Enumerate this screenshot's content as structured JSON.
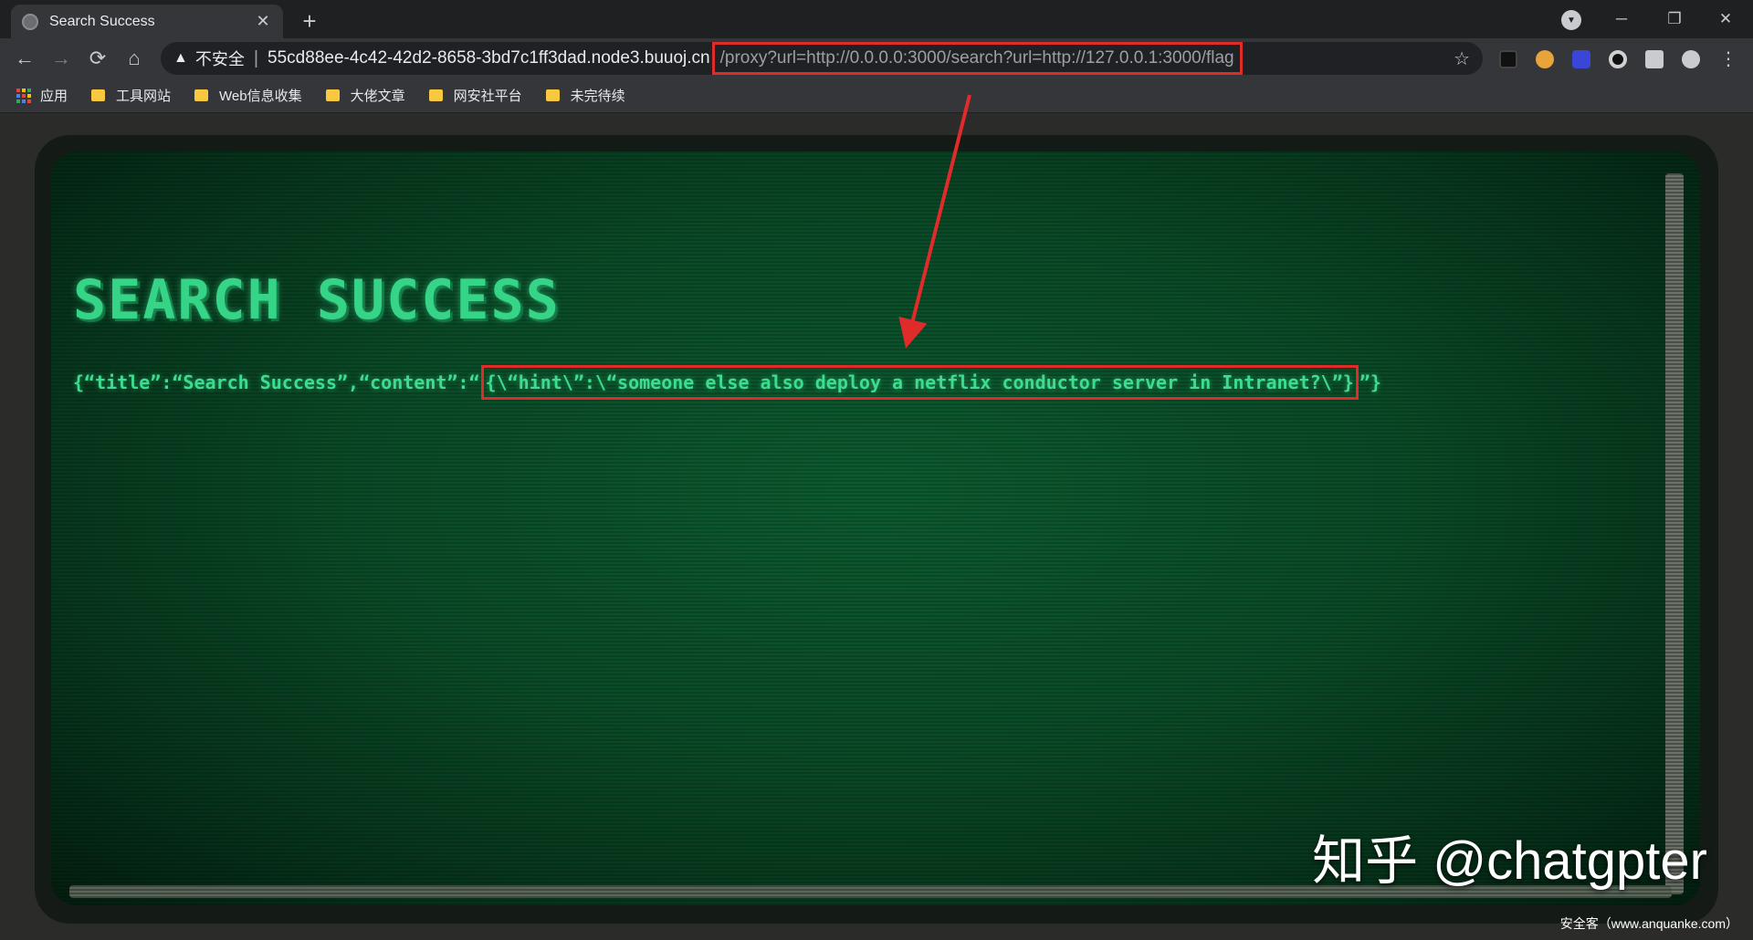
{
  "browser": {
    "tab_title": "Search Success",
    "tab_close": "✕",
    "new_tab": "+",
    "window_controls": {
      "minimize": "─",
      "restore": "❐",
      "close": "✕"
    },
    "nav": {
      "back": "←",
      "forward": "→",
      "reload": "⟳",
      "home": "⌂"
    },
    "address": {
      "security_icon": "▲",
      "security_label": "不安全",
      "separator": "|",
      "host": "55cd88ee-4c42-42d2-8658-3bd7c1ff3dad.node3.buuoj.cn",
      "path": "/proxy?url=http://0.0.0.0:3000/search?url=http://127.0.0.1:3000/flag",
      "star": "☆"
    },
    "bookmarks": [
      {
        "label": "应用",
        "icon": "apps-icon"
      },
      {
        "label": "工具网站",
        "icon": "folder-icon"
      },
      {
        "label": "Web信息收集",
        "icon": "folder-icon"
      },
      {
        "label": "大佬文章",
        "icon": "folder-icon"
      },
      {
        "label": "网安社平台",
        "icon": "folder-icon"
      },
      {
        "label": "未完待续",
        "icon": "folder-icon"
      }
    ]
  },
  "page": {
    "heading": "SEARCH SUCCESS",
    "json_prefix": "{“title”:“Search Success”,“content”:“",
    "json_highlight": "{\\“hint\\”:\\“someone else also deploy a netflix conductor server in Intranet?\\”}",
    "json_suffix": "”}"
  },
  "annotation": {
    "color": "#e02b2b"
  },
  "watermark": "知乎 @chatgpter",
  "source_credit": "安全客（www.anquanke.com）"
}
